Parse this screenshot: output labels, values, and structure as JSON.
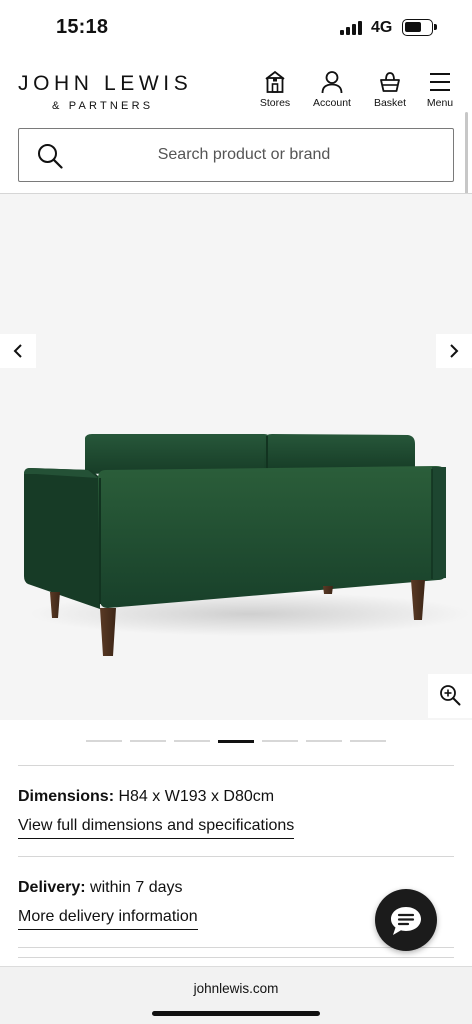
{
  "status_bar": {
    "time": "15:18",
    "network": "4G",
    "battery_level": 0.65,
    "signal_bars": 4
  },
  "header": {
    "logo_main": "JOHN LEWIS",
    "logo_sub": "& PARTNERS",
    "nav": [
      {
        "label": "Stores",
        "icon": "store-icon"
      },
      {
        "label": "Account",
        "icon": "account-icon"
      },
      {
        "label": "Basket",
        "icon": "basket-icon"
      },
      {
        "label": "Menu",
        "icon": "hamburger-icon"
      }
    ]
  },
  "search": {
    "placeholder": "Search product or brand",
    "value": ""
  },
  "gallery": {
    "image_count": 7,
    "active_index": 3,
    "sofa_color": "#1f4d2e"
  },
  "details": {
    "dimensions_label": "Dimensions:",
    "dimensions_value": "H84 x W193 x D80cm",
    "dimensions_link": "View full dimensions and specifications",
    "delivery_label": "Delivery:",
    "delivery_value": "within 7 days",
    "delivery_link": "More delivery information"
  },
  "browser": {
    "url": "johnlewis.com"
  }
}
